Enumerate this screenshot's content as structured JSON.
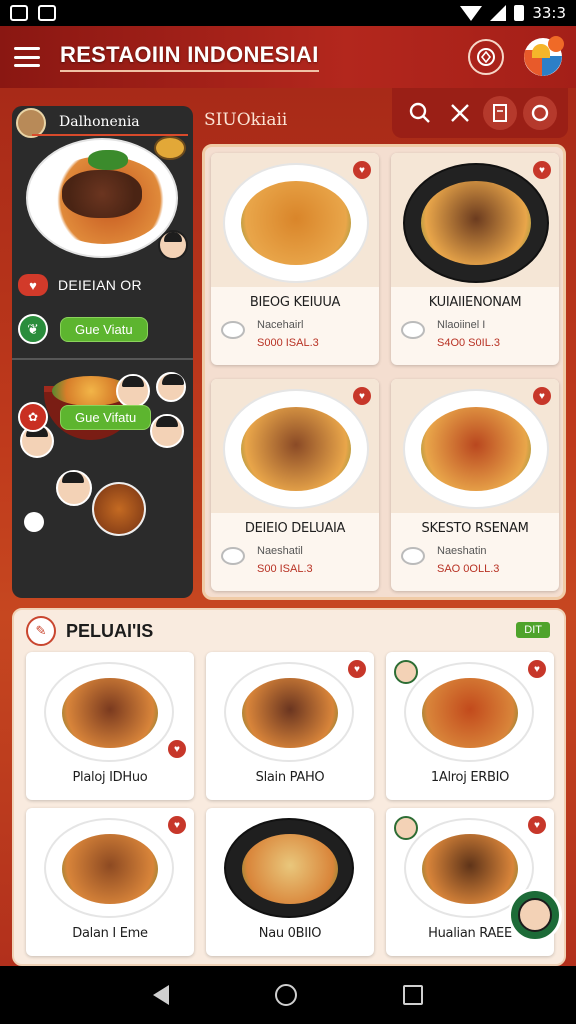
{
  "status_bar": {
    "time": "33:3",
    "icons": [
      "notification-icon",
      "photo-icon",
      "wifi-icon",
      "signal-icon",
      "battery-icon"
    ]
  },
  "app_bar": {
    "title": "RESTAOIIN INDONESIAI",
    "icons": [
      "menu-icon",
      "emblem-icon",
      "profile-icon"
    ]
  },
  "sidebar": {
    "user_name": "Dalhonenia",
    "label": "DEIEIAN OR",
    "button_1": "Gue Viatu",
    "button_2": "Gue Vifatu"
  },
  "section": {
    "label": "SIUOkiaii",
    "toolbar_icons": [
      "search-icon",
      "tools-icon",
      "bookmark-icon",
      "notification-icon"
    ]
  },
  "featured": [
    {
      "title": "BIEOG KEIUUA",
      "sub": "Nacehairl",
      "price": "S000 ISAL.3",
      "accent": "#d9852a"
    },
    {
      "title": "KUIAIIENONAM",
      "sub": "Nlaoiinel I",
      "price": "S4O0 S0IL.3",
      "accent": "#6b3b1f"
    },
    {
      "title": "DEIEIO DELUAIA",
      "sub": "Naeshatil",
      "price": "S00 ISAL.3",
      "accent": "#8a4a26"
    },
    {
      "title": "SKESTO RSENAM",
      "sub": "Naeshatin",
      "price": "SAO 0OLL.3",
      "accent": "#b9471f"
    }
  ],
  "lower_section": {
    "title": "PELUAI'IS",
    "tag": "DIT"
  },
  "lower_cards": [
    {
      "title": "Plaloj IDHuo",
      "accent": "#7a3a1f"
    },
    {
      "title": "Slain PAHO",
      "accent": "#6a3520"
    },
    {
      "title": "1Alroj ERBIO",
      "accent": "#c24a1c"
    },
    {
      "title": "Dalan I Eme",
      "accent": "#8d4a22"
    },
    {
      "title": "Nau 0BIIO",
      "accent": "#e9c77c"
    },
    {
      "title": "Hualian RAEE",
      "accent": "#5f3419"
    }
  ],
  "colors": {
    "brand_red": "#b3271d",
    "accent_green": "#5db52f",
    "panel_cream": "#f4ded0"
  }
}
